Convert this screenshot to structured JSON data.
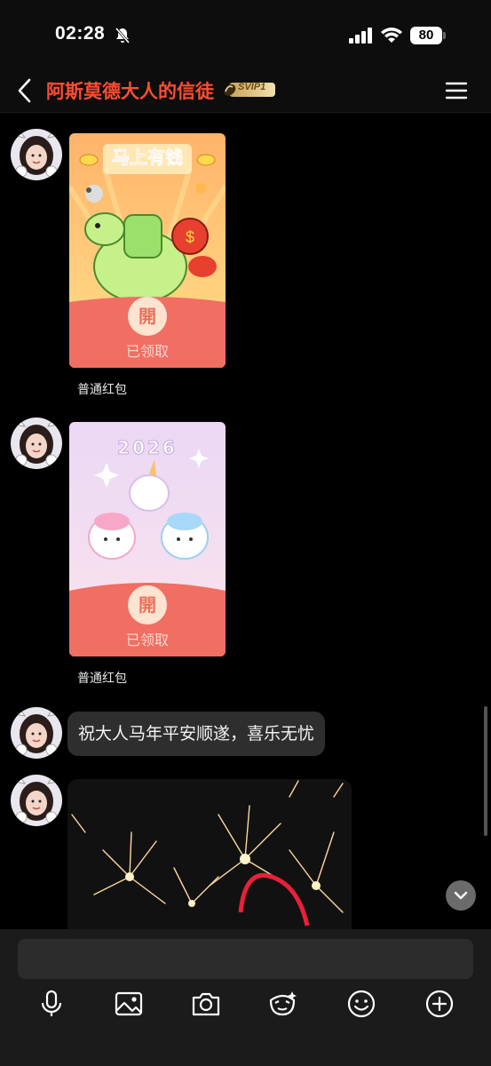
{
  "status_bar": {
    "time": "02:28",
    "battery": "80"
  },
  "header": {
    "title": "阿斯莫德大人的信徒",
    "badge": "SVIP1"
  },
  "messages": [
    {
      "type": "red_packet",
      "cover_text": "马上有钱",
      "open_glyph": "開",
      "status": "已领取",
      "label": "普通红包"
    },
    {
      "type": "red_packet",
      "cover_text": "2026",
      "open_glyph": "開",
      "status": "已领取",
      "label": "普通红包"
    },
    {
      "type": "text",
      "text": "祝大人马年平安顺遂，喜乐无忧"
    },
    {
      "type": "image"
    }
  ],
  "icons": [
    "back-icon",
    "menu-icon",
    "voice-icon",
    "image-icon",
    "camera-icon",
    "sticker-icon",
    "emoji-icon",
    "plus-icon",
    "chevron-down-icon"
  ],
  "colors": {
    "title": "#ff4d33",
    "packet_red": "#f06e62",
    "bubble": "#2e2e2e"
  }
}
